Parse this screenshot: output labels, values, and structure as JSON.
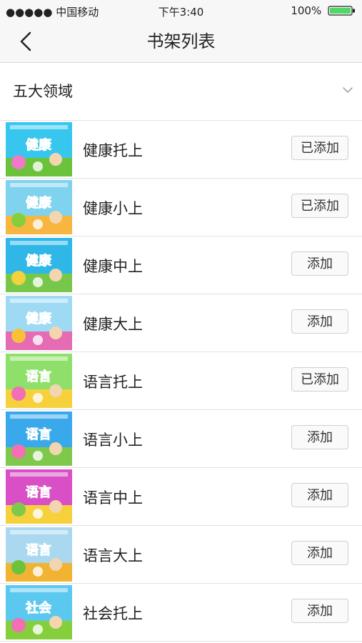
{
  "statusbar": {
    "carrier": "●●●●● 中国移动",
    "time": "下午3:40",
    "battery": "100%"
  },
  "navbar": {
    "title": "书架列表",
    "back_icon": "chevron-left-icon"
  },
  "filter": {
    "label": "五大领域",
    "icon": "chevron-down-icon"
  },
  "books": [
    {
      "name": "健康托上",
      "cover_text": "健康",
      "button": "已添加",
      "colors": [
        "#37c6ee",
        "#f07ac8",
        "#6cc33b"
      ]
    },
    {
      "name": "健康小上",
      "cover_text": "健康",
      "button": "已添加",
      "colors": [
        "#7fd3ee",
        "#86cf3c",
        "#f6b640"
      ]
    },
    {
      "name": "健康中上",
      "cover_text": "健康",
      "button": "添加",
      "colors": [
        "#2fb7e8",
        "#f2d23d",
        "#77c84a"
      ]
    },
    {
      "name": "健康大上",
      "cover_text": "健康",
      "button": "添加",
      "colors": [
        "#9edaf4",
        "#f7c13a",
        "#e56bb2"
      ]
    },
    {
      "name": "语言托上",
      "cover_text": "语言",
      "button": "已添加",
      "colors": [
        "#8fe06a",
        "#f06fb5",
        "#f6d13c"
      ]
    },
    {
      "name": "语言小上",
      "cover_text": "语言",
      "button": "添加",
      "colors": [
        "#3aa9ec",
        "#f46fb4",
        "#7ec84c"
      ]
    },
    {
      "name": "语言中上",
      "cover_text": "语言",
      "button": "添加",
      "colors": [
        "#d94fc6",
        "#7ec84c",
        "#f6d13c"
      ]
    },
    {
      "name": "语言大上",
      "cover_text": "语言",
      "button": "添加",
      "colors": [
        "#a9d8f0",
        "#6cc33b",
        "#f1b332"
      ]
    },
    {
      "name": "社会托上",
      "cover_text": "社会",
      "button": "添加",
      "colors": [
        "#5bc8ef",
        "#f06fb5",
        "#86cf3c"
      ]
    }
  ]
}
